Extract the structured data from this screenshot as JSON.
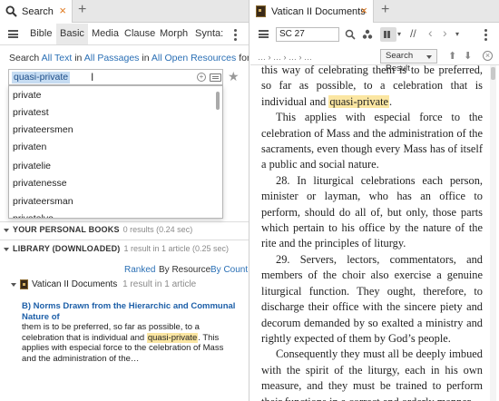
{
  "left": {
    "tab_title": "Search",
    "tab_close": "×",
    "new_tab": "+",
    "search_tabs": [
      "Bible",
      "Basic",
      "Media",
      "Clause",
      "Morph",
      "Synta:"
    ],
    "active_search_tab": "Basic",
    "search_for": {
      "prefix": "Search",
      "scope_text": "All Text",
      "in1": "in",
      "scope_passages": "All Passages",
      "in2": "in",
      "scope_resources": "All Open Resources",
      "suffix": "for"
    },
    "query": "quasi-private",
    "suggestions": [
      "private",
      "privatest",
      "privateersmen",
      "privaten",
      "privatelie",
      "privatenesse",
      "privateersman",
      "privatelyo"
    ],
    "personal_books": {
      "label": "YOUR PERSONAL BOOKS",
      "count": "0 results (0.24 sec)"
    },
    "library": {
      "label": "LIBRARY (DOWNLOADED)",
      "count": "1 result in 1 article (0.25 sec)"
    },
    "sort_options": [
      "Ranked",
      "By Resource",
      "By Count"
    ],
    "result_book": {
      "title": "Vatican II Documents",
      "count": "1 result in 1 article"
    },
    "hit": {
      "title": "B) Norms Drawn from the Hierarchic and Communal Nature of",
      "before": "them is to be preferred, so far as possible, to a celebration that is individual and",
      "highlight": "quasi-private",
      "after": ". This applies with especial force to the celebration of Mass and the administration of the…"
    }
  },
  "right": {
    "tab_title": "Vatican II Documents",
    "tab_close": "×",
    "new_tab": "+",
    "reference": "SC 27",
    "nav_crumbs": "… › … › … › …",
    "search_result_label": "Search Result",
    "text": {
      "p1_start": "this way of celebrating them is to be preferred, so far as possible, to a celebration that is individual and",
      "p1_hl": "quasi-private",
      "p1_end": ".",
      "p2": "This applies with especial force to the celebration of Mass and the administration of the sacraments, even though every Mass has of itself a public and social nature.",
      "p3": "28. In liturgical celebrations each person, minister or layman, who has an office to perform, should do all of, but only, those parts which pertain to his office by the nature of the rite and the principles of liturgy.",
      "p4": "29. Servers, lectors, commentators, and members of the choir also exercise a genuine liturgical function. They ought, therefore, to discharge their office with the sincere piety and decorum demanded by so exalted a ministry and rightly expected of them by God’s people.",
      "p5": "Consequently they must all be deeply imbued with the spirit of the liturgy, each in his own measure, and they must be trained to perform their functions in a correct and orderly manner."
    }
  },
  "colors": {
    "accent": "#e07a20",
    "link": "#2a6fb5",
    "highlight": "#fbe6a2",
    "selection": "#c6dcf2"
  }
}
